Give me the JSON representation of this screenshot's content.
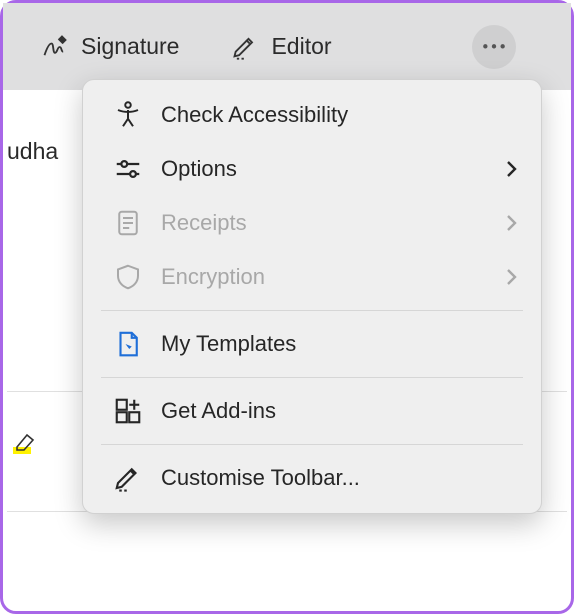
{
  "toolbar": {
    "signature_label": "Signature",
    "editor_label": "Editor"
  },
  "background_text": "udha",
  "menu": {
    "check_accessibility": "Check Accessibility",
    "options": "Options",
    "receipts": "Receipts",
    "encryption": "Encryption",
    "my_templates": "My Templates",
    "get_addins": "Get Add-ins",
    "customise_toolbar": "Customise Toolbar..."
  }
}
